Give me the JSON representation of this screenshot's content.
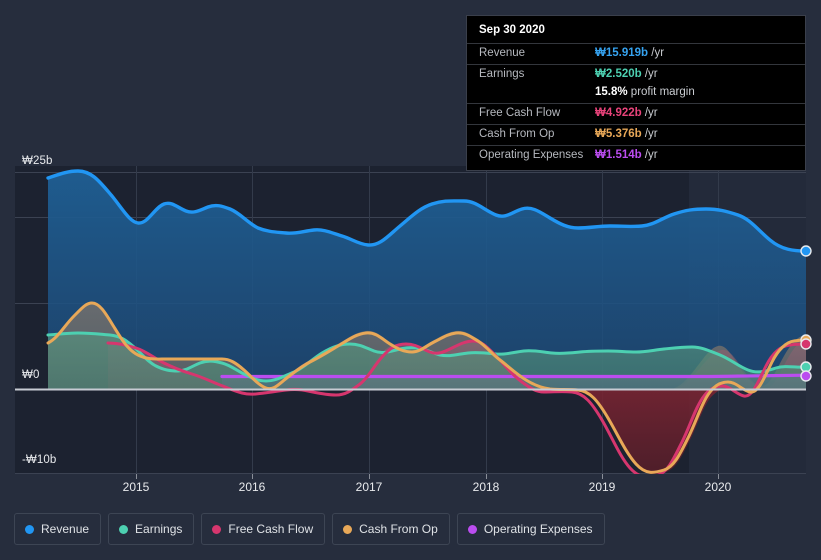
{
  "tooltip": {
    "date": "Sep 30 2020",
    "rows": [
      {
        "key": "Revenue",
        "value": "₩15.919b",
        "unit": " /yr",
        "color": "#36a3f0"
      },
      {
        "key": "Earnings",
        "value": "₩2.520b",
        "unit": " /yr",
        "color": "#4dd0b1"
      },
      {
        "key": "",
        "value": "15.8%",
        "unit": " profit margin",
        "color": "#ffffff"
      },
      {
        "key": "Free Cash Flow",
        "value": "₩4.922b",
        "unit": " /yr",
        "color": "#e8437a"
      },
      {
        "key": "Cash From Op",
        "value": "₩5.376b",
        "unit": " /yr",
        "color": "#e8a858"
      },
      {
        "key": "Operating Expenses",
        "value": "₩1.514b",
        "unit": " /yr",
        "color": "#bb4df0"
      }
    ]
  },
  "axes": {
    "y_top": "₩25b",
    "y_zero": "₩0",
    "y_bottom": "-₩10b",
    "x_ticks": [
      "2015",
      "2016",
      "2017",
      "2018",
      "2019",
      "2020"
    ]
  },
  "legend": [
    {
      "label": "Revenue",
      "color": "#2196f3"
    },
    {
      "label": "Earnings",
      "color": "#4dd0b1"
    },
    {
      "label": "Free Cash Flow",
      "color": "#d6366e"
    },
    {
      "label": "Cash From Op",
      "color": "#e8a858"
    },
    {
      "label": "Operating Expenses",
      "color": "#bb4df0"
    }
  ],
  "chart_data": {
    "type": "area",
    "title": "",
    "xlabel": "",
    "ylabel": "",
    "ylim": [
      -10,
      25
    ],
    "xlim": [
      "2014-06",
      "2020-12"
    ],
    "grid": true,
    "legend_position": "bottom",
    "currency": "₩ (billions)",
    "y_ticks": [
      25,
      0,
      -10
    ],
    "x_tick_labels": [
      "2015",
      "2016",
      "2017",
      "2018",
      "2019",
      "2020"
    ],
    "forecast_divider_x": "2020-01",
    "x": [
      "2014-06",
      "2014-09",
      "2014-12",
      "2015-03",
      "2015-06",
      "2015-09",
      "2015-12",
      "2016-03",
      "2016-06",
      "2016-09",
      "2016-12",
      "2017-03",
      "2017-06",
      "2017-09",
      "2017-12",
      "2018-03",
      "2018-06",
      "2018-09",
      "2018-12",
      "2019-03",
      "2019-06",
      "2019-09",
      "2019-12",
      "2020-03",
      "2020-06",
      "2020-09"
    ],
    "series": [
      {
        "name": "Revenue",
        "color": "#2196f3",
        "values": [
          24.6,
          25.5,
          24.2,
          20.7,
          22.0,
          21.2,
          21.7,
          21.9,
          20.1,
          19.4,
          19.2,
          19.6,
          21.3,
          22.1,
          20.5,
          20.3,
          20.9,
          19.5,
          19.6,
          19.6,
          20.3,
          20.4,
          20.1,
          18.6,
          17.0,
          15.919
        ]
      },
      {
        "name": "Earnings",
        "color": "#4dd0b1",
        "values": [
          6.3,
          6.4,
          6.3,
          5.7,
          4.0,
          3.4,
          3.8,
          4.1,
          3.4,
          2.9,
          3.2,
          4.1,
          4.6,
          4.2,
          4.4,
          4.1,
          3.9,
          4.3,
          4.2,
          4.1,
          4.2,
          4.3,
          4.4,
          3.9,
          3.0,
          2.52
        ]
      },
      {
        "name": "Free Cash Flow",
        "color": "#d6366e",
        "values": [
          null,
          null,
          null,
          5.4,
          5.3,
          4.3,
          3.1,
          3.2,
          2.0,
          0.9,
          -0.4,
          1.5,
          3.4,
          4.4,
          3.8,
          4.3,
          4.9,
          4.0,
          2.1,
          0.4,
          -0.2,
          -7.5,
          -9.8,
          -3.0,
          2.4,
          4.922
        ]
      },
      {
        "name": "Cash From Op",
        "color": "#e8a858",
        "values": [
          5.3,
          8.9,
          10.0,
          6.0,
          5.4,
          5.3,
          5.3,
          4.6,
          1.8,
          0.5,
          1.2,
          3.3,
          4.7,
          4.2,
          4.1,
          5.0,
          5.5,
          4.6,
          2.8,
          0.7,
          -0.1,
          -7.3,
          -9.6,
          -2.6,
          2.7,
          5.376
        ]
      },
      {
        "name": "Operating Expenses",
        "color": "#bb4df0",
        "values": [
          null,
          null,
          null,
          null,
          1.45,
          1.45,
          1.45,
          1.45,
          1.45,
          1.45,
          1.45,
          1.45,
          1.45,
          1.45,
          1.45,
          1.45,
          1.45,
          1.45,
          1.45,
          1.45,
          1.45,
          1.45,
          1.45,
          1.48,
          1.5,
          1.514
        ]
      }
    ]
  }
}
